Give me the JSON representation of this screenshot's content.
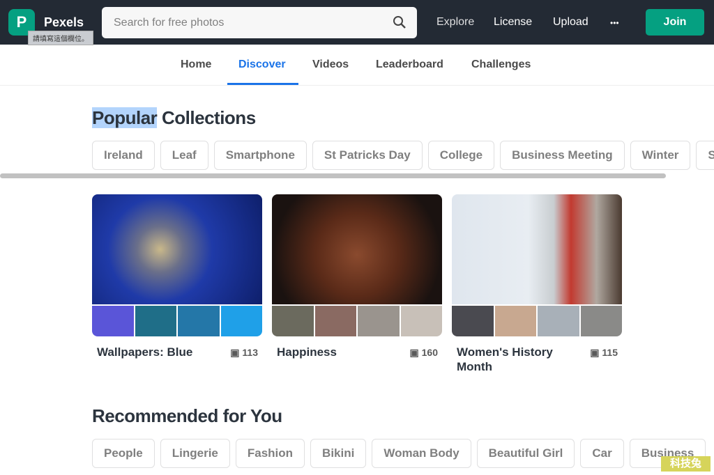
{
  "header": {
    "logo_letter": "P",
    "brand": "Pexels",
    "tooltip": "請填寫這個欄位。",
    "search_placeholder": "Search for free photos",
    "nav": [
      "Explore",
      "License",
      "Upload",
      "•••"
    ],
    "join": "Join"
  },
  "subnav": [
    {
      "label": "Home",
      "active": false
    },
    {
      "label": "Discover",
      "active": true
    },
    {
      "label": "Videos",
      "active": false
    },
    {
      "label": "Leaderboard",
      "active": false
    },
    {
      "label": "Challenges",
      "active": false
    }
  ],
  "popular": {
    "title_highlight": "Popular",
    "title_rest": " Collections",
    "chips": [
      "Ireland",
      "Leaf",
      "Smartphone",
      "St Patricks Day",
      "College",
      "Business Meeting",
      "Winter",
      "St"
    ]
  },
  "collections": [
    {
      "title": "Wallpapers: Blue",
      "count": "113"
    },
    {
      "title": "Happiness",
      "count": "160"
    },
    {
      "title": "Women's History Month",
      "count": "115"
    }
  ],
  "recommended": {
    "title": "Recommended for You",
    "chips": [
      "People",
      "Lingerie",
      "Fashion",
      "Bikini",
      "Woman Body",
      "Beautiful Girl",
      "Car",
      "Business"
    ]
  },
  "watermark": "科技兔",
  "colors": {
    "brand": "#05a081",
    "header": "#232a34",
    "active": "#1a73e8"
  }
}
